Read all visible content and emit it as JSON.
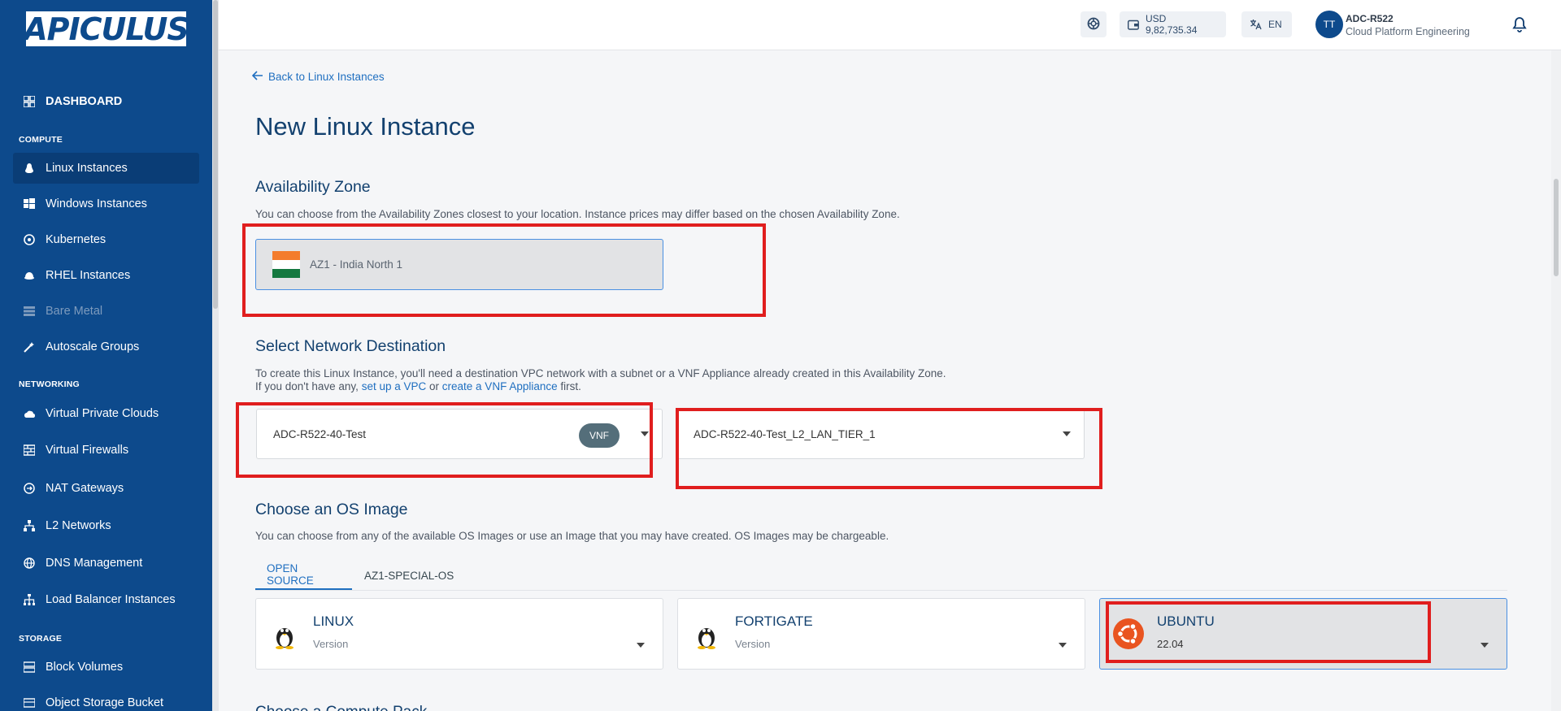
{
  "brand": {
    "logo_text": "APICULUS"
  },
  "sidebar": {
    "dashboard": "DASHBOARD",
    "sections": {
      "compute": "COMPUTE",
      "networking": "NETWORKING",
      "storage": "STORAGE"
    },
    "compute_items": [
      {
        "label": "Linux Instances",
        "icon": "linux-icon"
      },
      {
        "label": "Windows Instances",
        "icon": "windows-icon"
      },
      {
        "label": "Kubernetes",
        "icon": "kubernetes-icon"
      },
      {
        "label": "RHEL Instances",
        "icon": "rhel-icon"
      },
      {
        "label": "Bare Metal",
        "icon": "server-icon"
      },
      {
        "label": "Autoscale Groups",
        "icon": "autoscale-icon"
      }
    ],
    "networking_items": [
      {
        "label": "Virtual Private Clouds",
        "icon": "cloud-icon"
      },
      {
        "label": "Virtual Firewalls",
        "icon": "firewall-icon"
      },
      {
        "label": "NAT Gateways",
        "icon": "nat-icon"
      },
      {
        "label": "L2 Networks",
        "icon": "l2-network-icon"
      },
      {
        "label": "DNS Management",
        "icon": "globe-icon"
      },
      {
        "label": "Load Balancer Instances",
        "icon": "load-balancer-icon"
      }
    ],
    "storage_items": [
      {
        "label": "Block Volumes",
        "icon": "block-volume-icon"
      },
      {
        "label": "Object Storage Bucket",
        "icon": "bucket-icon"
      }
    ]
  },
  "topbar": {
    "balance": "USD 9,82,735.34",
    "language": "EN",
    "avatar_initials": "TT",
    "user_name": "ADC-R522",
    "user_org": "Cloud Platform Engineering"
  },
  "page": {
    "back_link": "Back to Linux Instances",
    "title": "New Linux Instance"
  },
  "availability_zone": {
    "title": "Availability Zone",
    "description": "You can choose from the Availability Zones closest to your location. Instance prices may differ based on the chosen Availability Zone.",
    "selected": "AZ1 - India North 1"
  },
  "network": {
    "title": "Select Network Destination",
    "description_line1": "To create this Linux Instance, you'll need a destination VPC network with a subnet or a VNF Appliance already created in this Availability Zone.",
    "line2_prefix": "If you don't have any,",
    "link_vpc": "set up a VPC",
    "or": "or",
    "link_vnf": "create a VNF Appliance",
    "line2_suffix": "first.",
    "destination_value": "ADC-R522-40-Test",
    "destination_badge": "VNF",
    "subnet_value": "ADC-R522-40-Test_L2_LAN_TIER_1"
  },
  "os_image": {
    "title": "Choose an OS Image",
    "description": "You can choose from any of the available OS Images or use an Image that you may have created. OS Images may be chargeable.",
    "tabs": [
      "OPEN SOURCE",
      "AZ1-SPECIAL-OS"
    ],
    "cards": [
      {
        "name": "LINUX",
        "version": "Version"
      },
      {
        "name": "FORTIGATE",
        "version": "Version"
      },
      {
        "name": "UBUNTU",
        "version": "22.04"
      }
    ]
  },
  "next_section": {
    "title": "Choose a Compute Pack"
  },
  "colors": {
    "sidebar": "#0d4a8c",
    "accent": "#1f6fc0",
    "highlight": "#e01e1e"
  }
}
